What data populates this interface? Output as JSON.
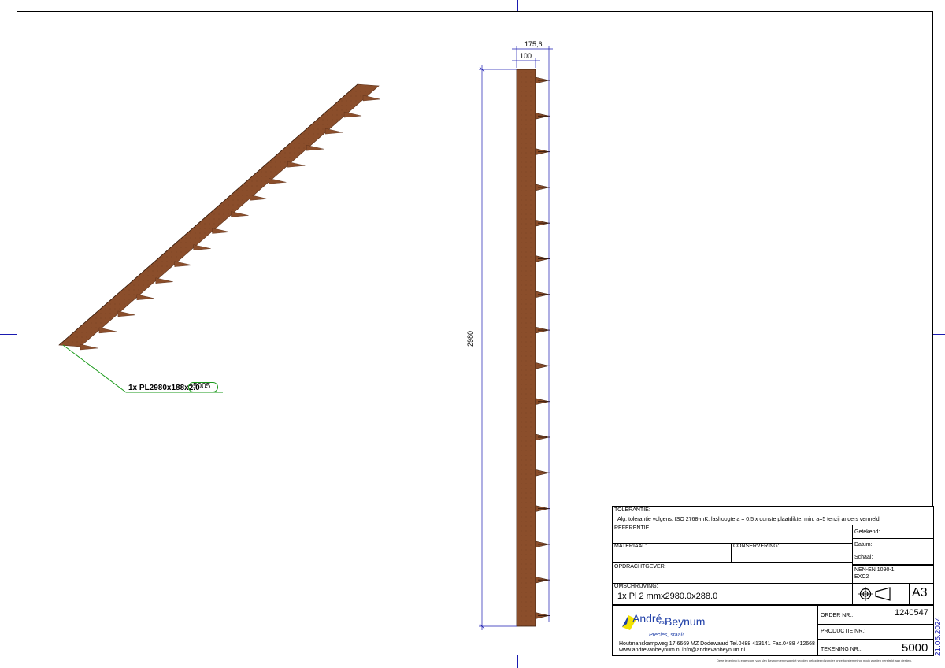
{
  "drawing": {
    "part_label": "1x PL2980x188x2.0",
    "part_mark": "5005",
    "dim_total_width": "175,6",
    "dim_plate_width": "100",
    "dim_length": "2980",
    "date_stamp": "21.05.2024"
  },
  "title_block": {
    "tolerance_label": "TOLERANTIE:",
    "tolerance_text": "Alg. tolerantie volgens: ISO 2768-mK, lashoogte a = 0.5 x dunste plaatdikte, min. a=5 tenzij anders vermeld",
    "reference_label": "REFERENTIE:",
    "material_label": "MATERIAAL:",
    "conservation_label": "CONSERVERING:",
    "drawn_label": "Getekend:",
    "date_label": "Datum:",
    "scale_label": "Schaal:",
    "client_label": "OPDRACHTGEVER:",
    "standard_line1": "NEN-EN 1090-1",
    "standard_line2": "EXC2",
    "description_label": "OMSCHRIJVING:",
    "description_value": "1x Pl 2 mmx2980.0x288.0",
    "sheet_size": "A3",
    "order_label": "ORDER NR.:",
    "order_value": "1240547",
    "production_label": "PRODUCTIE NR.:",
    "production_value": "",
    "drawing_no_label": "TEKENING NR.:",
    "drawing_no_value": "5000",
    "company_name_1": "André",
    "company_name_2": "van",
    "company_name_3": "Beynum",
    "company_slogan": "Precies, staal!",
    "company_address": "Houtmanskampweg 17 6669 MZ Dodewaard Tel.0488 413141 Fax.0488 412668",
    "company_web": "www.andrevanbeynum.nl info@andrevanbeynum.nl",
    "disclaimer": "Deze tekening is eigendom van Van Beynum en mag niet worden gekopieerd zonder onze toestemming, noch worden verstrekt aan derden."
  },
  "colors": {
    "steel": "#8B4E2B",
    "steel_dark": "#5a2f18",
    "frame_blue": "#1a1ab0",
    "leader_green": "#1a9a1a",
    "logo_yellow": "#f2e200",
    "logo_blue": "#1f3fa8"
  }
}
